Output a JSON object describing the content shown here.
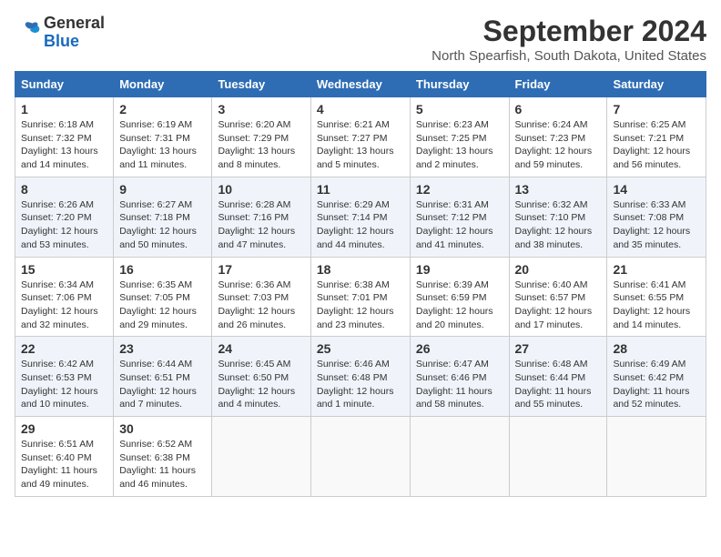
{
  "logo": {
    "general": "General",
    "blue": "Blue"
  },
  "title": "September 2024",
  "location": "North Spearfish, South Dakota, United States",
  "weekdays": [
    "Sunday",
    "Monday",
    "Tuesday",
    "Wednesday",
    "Thursday",
    "Friday",
    "Saturday"
  ],
  "weeks": [
    [
      {
        "day": "1",
        "sunrise": "6:18 AM",
        "sunset": "7:32 PM",
        "daylight": "13 hours and 14 minutes."
      },
      {
        "day": "2",
        "sunrise": "6:19 AM",
        "sunset": "7:31 PM",
        "daylight": "13 hours and 11 minutes."
      },
      {
        "day": "3",
        "sunrise": "6:20 AM",
        "sunset": "7:29 PM",
        "daylight": "13 hours and 8 minutes."
      },
      {
        "day": "4",
        "sunrise": "6:21 AM",
        "sunset": "7:27 PM",
        "daylight": "13 hours and 5 minutes."
      },
      {
        "day": "5",
        "sunrise": "6:23 AM",
        "sunset": "7:25 PM",
        "daylight": "13 hours and 2 minutes."
      },
      {
        "day": "6",
        "sunrise": "6:24 AM",
        "sunset": "7:23 PM",
        "daylight": "12 hours and 59 minutes."
      },
      {
        "day": "7",
        "sunrise": "6:25 AM",
        "sunset": "7:21 PM",
        "daylight": "12 hours and 56 minutes."
      }
    ],
    [
      {
        "day": "8",
        "sunrise": "6:26 AM",
        "sunset": "7:20 PM",
        "daylight": "12 hours and 53 minutes."
      },
      {
        "day": "9",
        "sunrise": "6:27 AM",
        "sunset": "7:18 PM",
        "daylight": "12 hours and 50 minutes."
      },
      {
        "day": "10",
        "sunrise": "6:28 AM",
        "sunset": "7:16 PM",
        "daylight": "12 hours and 47 minutes."
      },
      {
        "day": "11",
        "sunrise": "6:29 AM",
        "sunset": "7:14 PM",
        "daylight": "12 hours and 44 minutes."
      },
      {
        "day": "12",
        "sunrise": "6:31 AM",
        "sunset": "7:12 PM",
        "daylight": "12 hours and 41 minutes."
      },
      {
        "day": "13",
        "sunrise": "6:32 AM",
        "sunset": "7:10 PM",
        "daylight": "12 hours and 38 minutes."
      },
      {
        "day": "14",
        "sunrise": "6:33 AM",
        "sunset": "7:08 PM",
        "daylight": "12 hours and 35 minutes."
      }
    ],
    [
      {
        "day": "15",
        "sunrise": "6:34 AM",
        "sunset": "7:06 PM",
        "daylight": "12 hours and 32 minutes."
      },
      {
        "day": "16",
        "sunrise": "6:35 AM",
        "sunset": "7:05 PM",
        "daylight": "12 hours and 29 minutes."
      },
      {
        "day": "17",
        "sunrise": "6:36 AM",
        "sunset": "7:03 PM",
        "daylight": "12 hours and 26 minutes."
      },
      {
        "day": "18",
        "sunrise": "6:38 AM",
        "sunset": "7:01 PM",
        "daylight": "12 hours and 23 minutes."
      },
      {
        "day": "19",
        "sunrise": "6:39 AM",
        "sunset": "6:59 PM",
        "daylight": "12 hours and 20 minutes."
      },
      {
        "day": "20",
        "sunrise": "6:40 AM",
        "sunset": "6:57 PM",
        "daylight": "12 hours and 17 minutes."
      },
      {
        "day": "21",
        "sunrise": "6:41 AM",
        "sunset": "6:55 PM",
        "daylight": "12 hours and 14 minutes."
      }
    ],
    [
      {
        "day": "22",
        "sunrise": "6:42 AM",
        "sunset": "6:53 PM",
        "daylight": "12 hours and 10 minutes."
      },
      {
        "day": "23",
        "sunrise": "6:44 AM",
        "sunset": "6:51 PM",
        "daylight": "12 hours and 7 minutes."
      },
      {
        "day": "24",
        "sunrise": "6:45 AM",
        "sunset": "6:50 PM",
        "daylight": "12 hours and 4 minutes."
      },
      {
        "day": "25",
        "sunrise": "6:46 AM",
        "sunset": "6:48 PM",
        "daylight": "12 hours and 1 minute."
      },
      {
        "day": "26",
        "sunrise": "6:47 AM",
        "sunset": "6:46 PM",
        "daylight": "11 hours and 58 minutes."
      },
      {
        "day": "27",
        "sunrise": "6:48 AM",
        "sunset": "6:44 PM",
        "daylight": "11 hours and 55 minutes."
      },
      {
        "day": "28",
        "sunrise": "6:49 AM",
        "sunset": "6:42 PM",
        "daylight": "11 hours and 52 minutes."
      }
    ],
    [
      {
        "day": "29",
        "sunrise": "6:51 AM",
        "sunset": "6:40 PM",
        "daylight": "11 hours and 49 minutes."
      },
      {
        "day": "30",
        "sunrise": "6:52 AM",
        "sunset": "6:38 PM",
        "daylight": "11 hours and 46 minutes."
      },
      null,
      null,
      null,
      null,
      null
    ]
  ],
  "labels": {
    "sunrise": "Sunrise:",
    "sunset": "Sunset:",
    "daylight": "Daylight:"
  }
}
